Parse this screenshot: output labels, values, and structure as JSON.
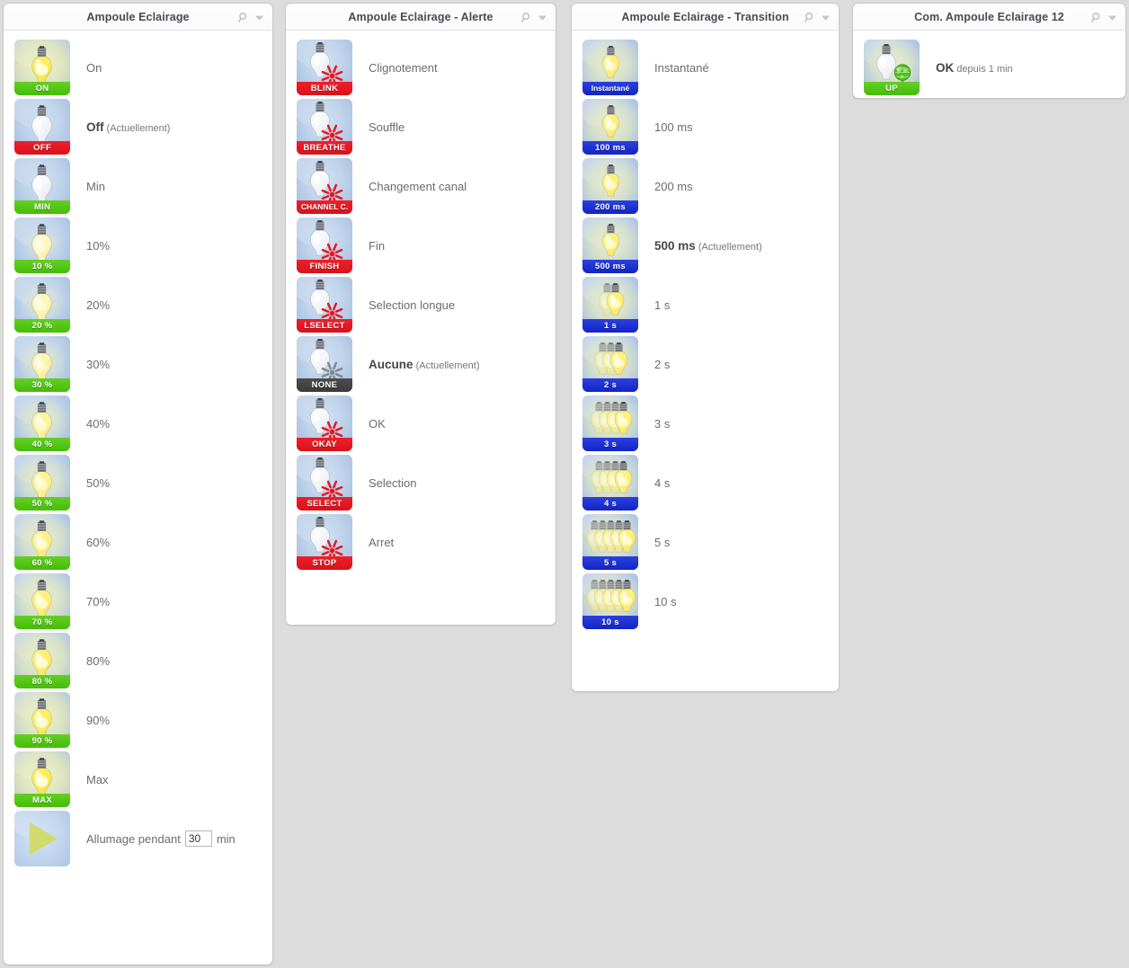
{
  "colors": {
    "page_bg": "#dcdcdc",
    "badge_green": "#4abd10",
    "badge_red": "#e0151f",
    "badge_blue": "#1f2fd0",
    "badge_dark": "#444444",
    "text": "#6b6b72"
  },
  "header_icons": {
    "search": "search-icon",
    "caret": "chevron-down-icon"
  },
  "panels": [
    {
      "id": "eclairage",
      "title": "Ampoule Eclairage",
      "rows": [
        {
          "label": "On",
          "badge": "ON",
          "badge_color": "green",
          "level": 100,
          "current": false
        },
        {
          "label": "Off",
          "badge": "OFF",
          "badge_color": "red",
          "level": 0,
          "current": true,
          "current_note": "(Actuellement)"
        },
        {
          "label": "Min",
          "badge": "MIN",
          "badge_color": "green",
          "level": 3,
          "current": false
        },
        {
          "label": "10%",
          "badge": "10 %",
          "badge_color": "green",
          "level": 10,
          "current": false
        },
        {
          "label": "20%",
          "badge": "20 %",
          "badge_color": "green",
          "level": 20,
          "current": false
        },
        {
          "label": "30%",
          "badge": "30 %",
          "badge_color": "green",
          "level": 30,
          "current": false
        },
        {
          "label": "40%",
          "badge": "40 %",
          "badge_color": "green",
          "level": 40,
          "current": false
        },
        {
          "label": "50%",
          "badge": "50 %",
          "badge_color": "green",
          "level": 50,
          "current": false
        },
        {
          "label": "60%",
          "badge": "60 %",
          "badge_color": "green",
          "level": 60,
          "current": false
        },
        {
          "label": "70%",
          "badge": "70 %",
          "badge_color": "green",
          "level": 70,
          "current": false
        },
        {
          "label": "80%",
          "badge": "80 %",
          "badge_color": "green",
          "level": 80,
          "current": false
        },
        {
          "label": "90%",
          "badge": "90 %",
          "badge_color": "green",
          "level": 90,
          "current": false
        },
        {
          "label": "Max",
          "badge": "MAX",
          "badge_color": "green",
          "level": 100,
          "current": false
        }
      ],
      "timer_row": {
        "prefix": "Allumage pendant",
        "value": "30",
        "suffix": "min",
        "icon": "play-icon"
      }
    },
    {
      "id": "alerte",
      "title": "Ampoule Eclairage - Alerte",
      "rows": [
        {
          "label": "Clignotement",
          "badge": "BLINK",
          "badge_color": "red",
          "alert": true,
          "current": false
        },
        {
          "label": "Souffle",
          "badge": "BREATHE",
          "badge_color": "red",
          "alert": true,
          "current": false
        },
        {
          "label": "Changement canal",
          "badge": "CHANNEL C.",
          "badge_color": "red",
          "alert": true,
          "current": false
        },
        {
          "label": "Fin",
          "badge": "FINISH",
          "badge_color": "red",
          "alert": true,
          "current": false
        },
        {
          "label": "Selection longue",
          "badge": "LSELECT",
          "badge_color": "red",
          "alert": true,
          "current": false
        },
        {
          "label": "Aucune",
          "badge": "NONE",
          "badge_color": "dark",
          "alert": true,
          "current": true,
          "current_note": "(Actuellement)"
        },
        {
          "label": "OK",
          "badge": "OKAY",
          "badge_color": "red",
          "alert": true,
          "current": false
        },
        {
          "label": "Selection",
          "badge": "SELECT",
          "badge_color": "red",
          "alert": true,
          "current": false
        },
        {
          "label": "Arret",
          "badge": "STOP",
          "badge_color": "red",
          "alert": true,
          "current": false
        }
      ]
    },
    {
      "id": "transition",
      "title": "Ampoule Eclairage - Transition",
      "rows": [
        {
          "label": "Instantané",
          "badge": "Instantané",
          "badge_color": "blue",
          "bulbs": 1,
          "current": false
        },
        {
          "label": "100 ms",
          "badge": "100 ms",
          "badge_color": "blue",
          "bulbs": 1,
          "current": false
        },
        {
          "label": "200 ms",
          "badge": "200 ms",
          "badge_color": "blue",
          "bulbs": 1,
          "current": false
        },
        {
          "label": "500 ms",
          "badge": "500 ms",
          "badge_color": "blue",
          "bulbs": 1,
          "current": true,
          "current_note": "(Actuellement)"
        },
        {
          "label": "1 s",
          "badge": "1 s",
          "badge_color": "blue",
          "bulbs": 2,
          "current": false
        },
        {
          "label": "2 s",
          "badge": "2 s",
          "badge_color": "blue",
          "bulbs": 3,
          "current": false
        },
        {
          "label": "3 s",
          "badge": "3 s",
          "badge_color": "blue",
          "bulbs": 4,
          "current": false
        },
        {
          "label": "4 s",
          "badge": "4 s",
          "badge_color": "blue",
          "bulbs": 4,
          "current": false
        },
        {
          "label": "5 s",
          "badge": "5 s",
          "badge_color": "blue",
          "bulbs": 5,
          "current": false
        },
        {
          "label": "10 s",
          "badge": "10 s",
          "badge_color": "blue",
          "bulbs": 5,
          "current": false
        }
      ]
    },
    {
      "id": "com",
      "title": "Com. Ampoule Eclairage 12",
      "rows": [
        {
          "label": "OK",
          "badge": "UP",
          "badge_color": "green",
          "globe": true,
          "current": true,
          "current_note": "depuis 1 min"
        }
      ]
    }
  ]
}
